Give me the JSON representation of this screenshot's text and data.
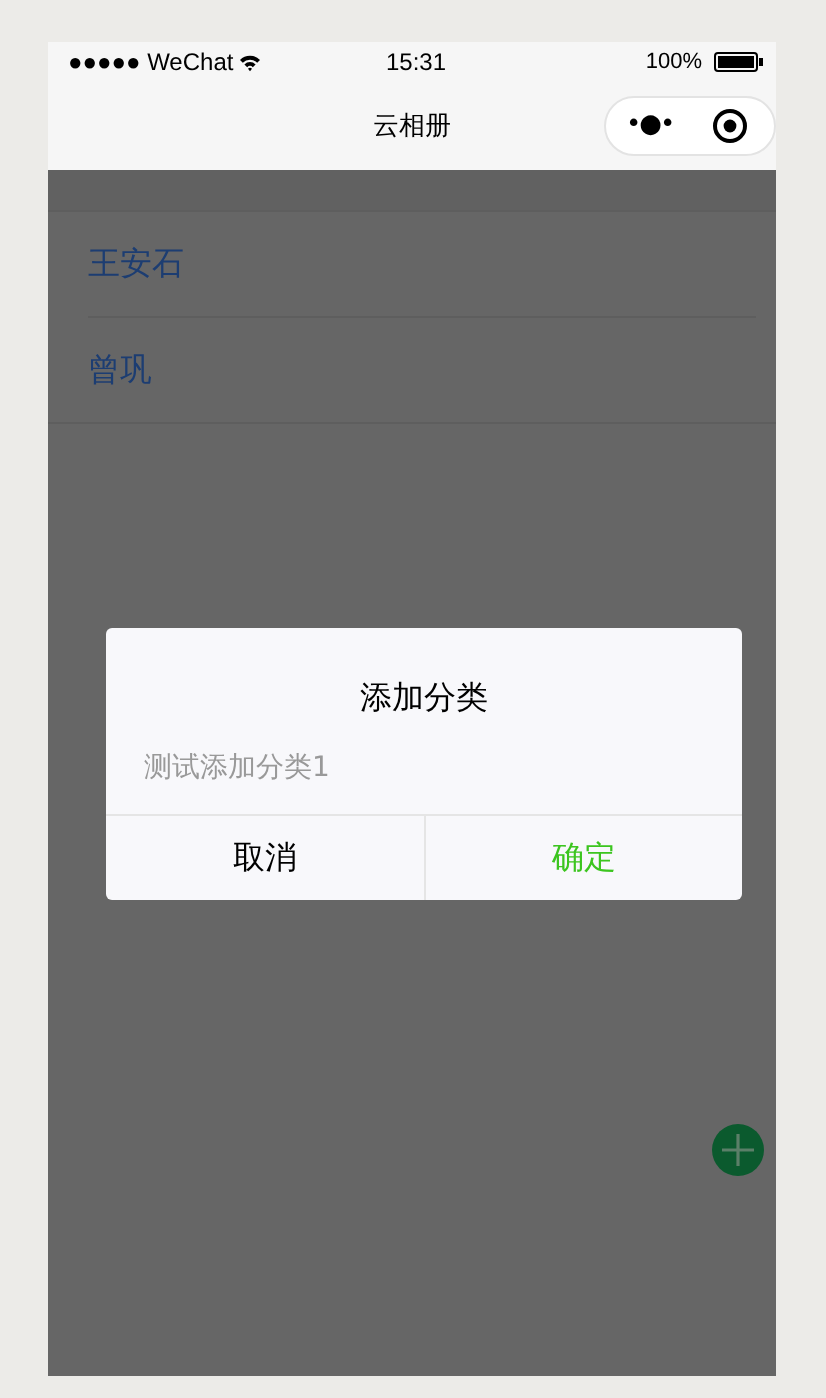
{
  "status_bar": {
    "carrier": "●●●●● WeChat",
    "time": "15:31",
    "battery": "100%"
  },
  "nav_bar": {
    "title": "云相册",
    "menu_icon": "•●•"
  },
  "list": {
    "items": [
      {
        "label": "王安石"
      },
      {
        "label": "曾巩"
      }
    ]
  },
  "dialog": {
    "title": "添加分类",
    "input": {
      "placeholder": "测试添加分类1"
    },
    "buttons": [
      {
        "label": "取消",
        "kind": "cancel"
      },
      {
        "label": "确定",
        "kind": "confirm"
      }
    ]
  }
}
